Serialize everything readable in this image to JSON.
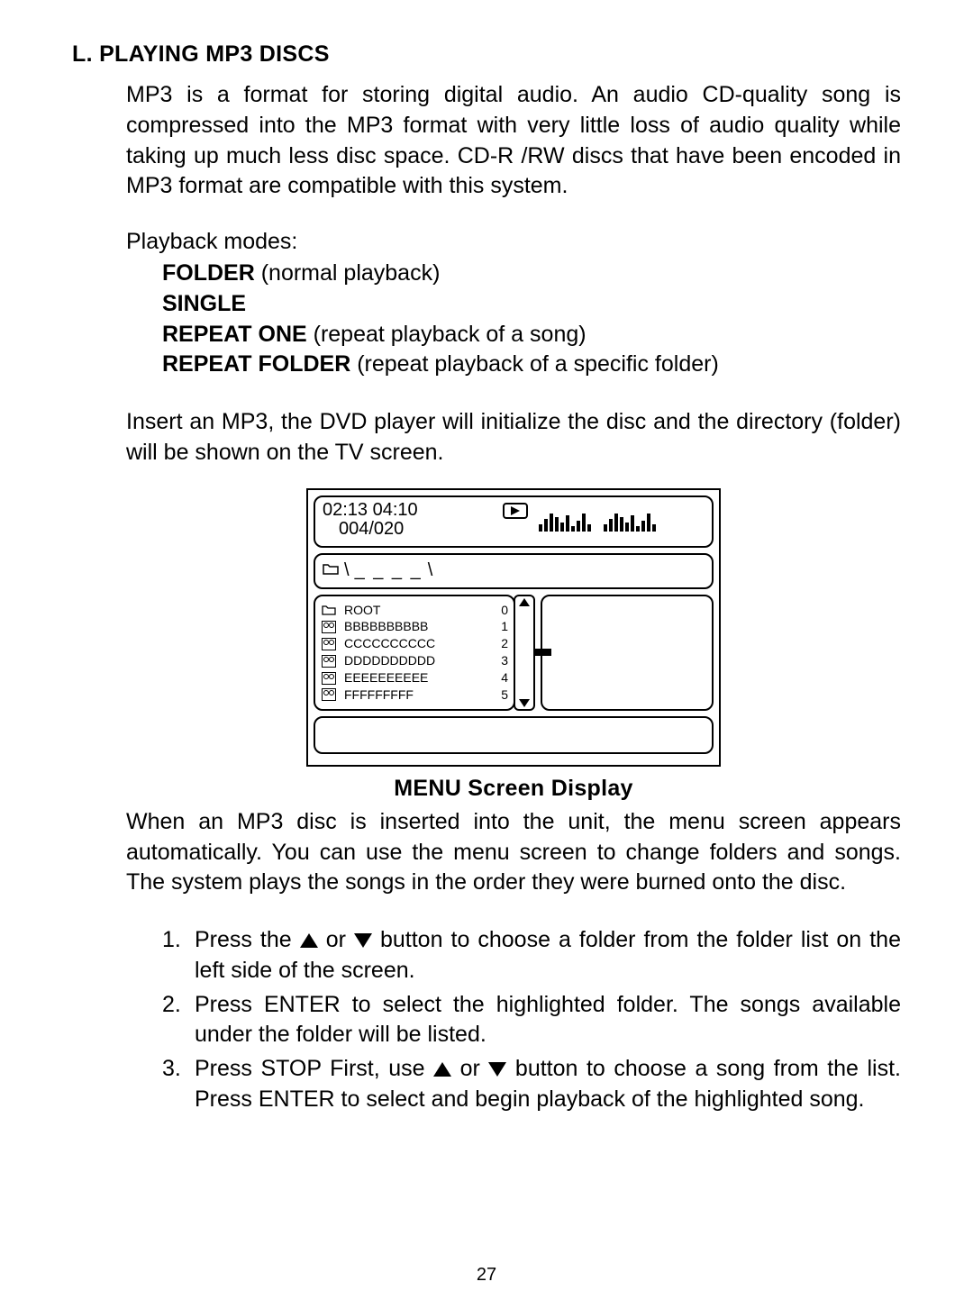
{
  "section_title": "L. PLAYING MP3 DISCS",
  "intro": "MP3 is a format for storing digital audio. An audio CD-quality song is compressed into the MP3 format with very little  loss of audio quality while taking up much less disc space.  CD-R /RW discs that have been encoded in MP3 format are compatible with this system.",
  "playback_modes_lead": "Playback modes:",
  "modes": [
    {
      "bold": "FOLDER",
      "rest": "  (normal playback)"
    },
    {
      "bold": "SINGLE",
      "rest": ""
    },
    {
      "bold": "REPEAT ONE",
      "rest": "  (repeat playback of a song)"
    },
    {
      "bold": "REPEAT FOLDER",
      "rest": "  (repeat playback of a specific folder)"
    }
  ],
  "insert_text": "Insert an MP3, the DVD  player will initialize the disc and the directory (folder) will be shown on the TV screen.",
  "screen": {
    "time_elapsed": "02:13",
    "time_total": "04:10",
    "track_index": "004/020",
    "path_dashes": "_ _ _ _",
    "list": [
      {
        "type": "folder",
        "name": "ROOT",
        "index": "0"
      },
      {
        "type": "mp3",
        "name": "BBBBBBBBBB",
        "index": "1"
      },
      {
        "type": "mp3",
        "name": "CCCCCCCCCC",
        "index": "2"
      },
      {
        "type": "mp3",
        "name": "DDDDDDDDDD",
        "index": "3"
      },
      {
        "type": "mp3",
        "name": "EEEEEEEEEE",
        "index": "4"
      },
      {
        "type": "mp3",
        "name": "FFFFFFFFF",
        "index": "5"
      }
    ]
  },
  "menu_caption": "MENU Screen Display",
  "menu_desc": "When an MP3 disc is inserted into the unit, the menu screen appears automatically. You can use the menu screen to change folders and songs. The system plays the songs in the order they were burned onto the disc.",
  "steps": [
    {
      "n": "1.",
      "pre": "Press the ",
      "mid": " or ",
      "post": " button to choose a folder from the folder list on the left side of the screen."
    },
    {
      "n": "2.",
      "text": "Press ENTER to select the highlighted folder.  The songs available under the folder will be listed."
    },
    {
      "n": "3.",
      "pre": "Press STOP First, use ",
      "mid": " or ",
      "post": " button to choose a song from the list. Press ENTER to select and begin playback of the highlighted song."
    }
  ],
  "page_number": "27"
}
